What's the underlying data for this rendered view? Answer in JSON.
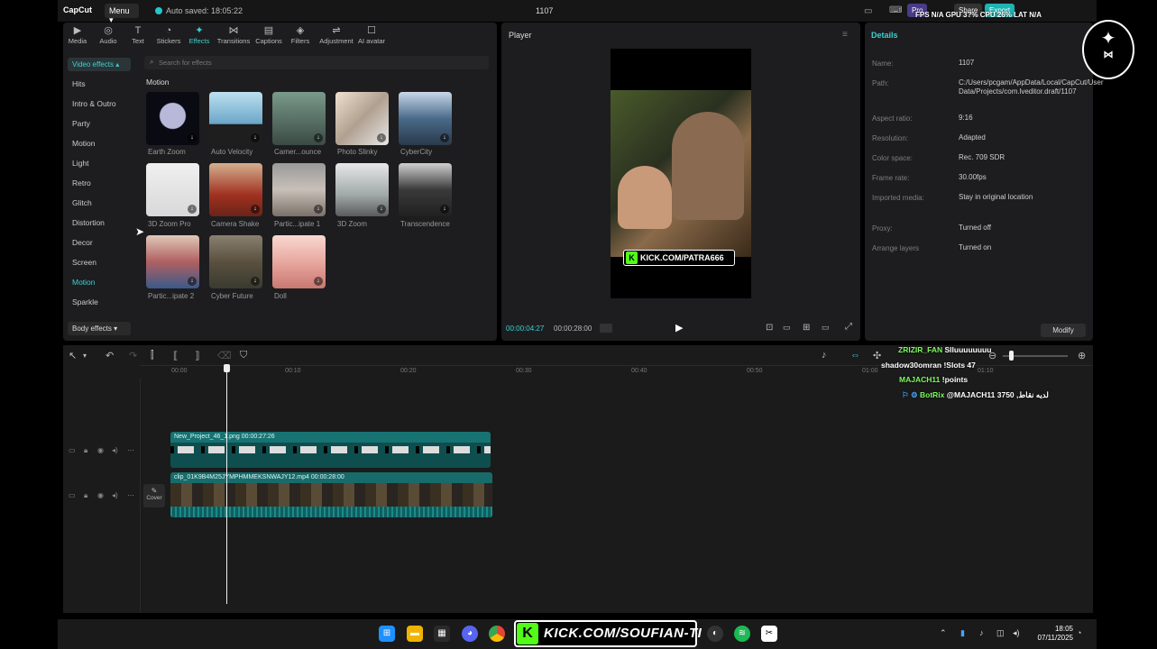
{
  "topbar": {
    "logo": "CapCut",
    "menu": "Menu",
    "autosave": "Auto saved: 18:05:22",
    "project_title": "1107",
    "pro_label": "Pro",
    "share_label": "Share",
    "export_label": "Export",
    "stats": "FPS N/A   GPU 3?%   CPU 26%   LAT N/A"
  },
  "tool_tabs": [
    {
      "label": "Media",
      "icon": "media-icon"
    },
    {
      "label": "Audio",
      "icon": "audio-icon"
    },
    {
      "label": "Text",
      "icon": "text-icon"
    },
    {
      "label": "Stickers",
      "icon": "stickers-icon"
    },
    {
      "label": "Effects",
      "icon": "effects-icon",
      "active": true
    },
    {
      "label": "Transitions",
      "icon": "transitions-icon"
    },
    {
      "label": "Captions",
      "icon": "captions-icon"
    },
    {
      "label": "Filters",
      "icon": "filters-icon"
    },
    {
      "label": "Adjustment",
      "icon": "adjustment-icon"
    },
    {
      "label": "AI avatar",
      "icon": "ai-avatar-icon"
    }
  ],
  "effects": {
    "category_header": "Video effects",
    "categories": [
      "Hits",
      "Intro & Outro",
      "Party",
      "Motion",
      "Light",
      "Retro",
      "Glitch",
      "Distortion",
      "Decor",
      "Screen",
      "Motion",
      "Sparkle"
    ],
    "active_category": "Motion",
    "body_effects": "Body effects",
    "search_placeholder": "Search for effects",
    "section_title": "Motion",
    "items": [
      "Earth Zoom",
      "Auto Velocity",
      "Camer...ounce",
      "Photo Slinky",
      "CyberCity",
      "3D Zoom Pro",
      "Camera Shake",
      "Partic...ipate 1",
      "3D Zoom",
      "Transcendence",
      "Partic...ipate 2",
      "Cyber Future",
      "Doll"
    ]
  },
  "player": {
    "title": "Player",
    "time_current": "00:00:04:27",
    "time_total": "00:00:28:00",
    "overlay_text": "KICK.COM/PATRA666"
  },
  "details": {
    "title": "Details",
    "rows": [
      {
        "key": "Name:",
        "value": "1107"
      },
      {
        "key": "Path:",
        "value": "C:/Users/pcgam/AppData/Local/CapCut/User Data/Projects/com.lveditor.draft/1107"
      },
      {
        "key": "Aspect ratio:",
        "value": "9:16"
      },
      {
        "key": "Resolution:",
        "value": "Adapted"
      },
      {
        "key": "Color space:",
        "value": "Rec. 709 SDR"
      },
      {
        "key": "Frame rate:",
        "value": "30.00fps"
      },
      {
        "key": "Imported media:",
        "value": "Stay in original location"
      },
      {
        "key": "Proxy:",
        "value": "Turned off"
      },
      {
        "key": "Arrange layers",
        "value": "Turned on"
      }
    ],
    "modify": "Modify"
  },
  "timeline": {
    "ruler": [
      "00:00",
      "00:10",
      "00:20",
      "00:30",
      "00:40",
      "00:50",
      "01:00",
      "01:10"
    ],
    "text_clip": "New_Project_46_1.png   00:00:27:26",
    "video_clip": "clip_01K9B4M25JYMPHMMEKSNWAJY12.mp4   00:00:28:00",
    "cover": "Cover"
  },
  "chat": [
    {
      "user": "ZRIZIR_FAN",
      "msg": "Slluuuuuuuu",
      "color": "#7cfc5a"
    },
    {
      "user": "shadow30omran",
      "msg": "!Slots 47",
      "color": "#ffffff"
    },
    {
      "user": "MAJACH11",
      "msg": "!points",
      "color": "#7cfc5a"
    },
    {
      "user": "BotRix",
      "msg": "@MAJACH11 3750 ,لديه نقاط",
      "color": "#7cfc5a"
    }
  ],
  "taskbar": {
    "kick_banner": "KICK.COM/SOUFIAN-TI",
    "time": "18:05",
    "date": "07/11/2025"
  },
  "colors": {
    "accent": "#3ad1d1",
    "kick_green": "#53fc18",
    "panel_bg": "#1d1d1f"
  }
}
